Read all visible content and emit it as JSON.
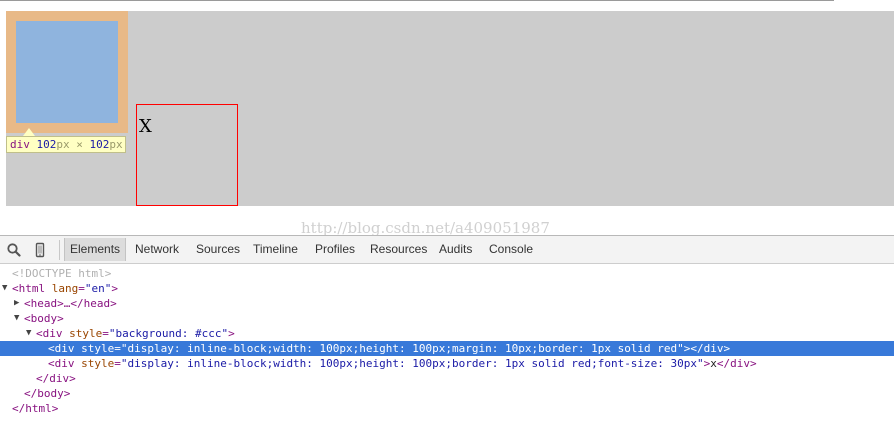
{
  "highlight_tooltip": {
    "tag": "div",
    "width": "102",
    "height": "102",
    "unit": "px",
    "times": "×"
  },
  "page_box_text": "X",
  "watermark": "http://blog.csdn.net/a409051987",
  "devtools": {
    "tabs": [
      {
        "label": "Elements",
        "active": true
      },
      {
        "label": "Network"
      },
      {
        "label": "Sources"
      },
      {
        "label": "Timeline"
      },
      {
        "label": "Profiles"
      },
      {
        "label": "Resources"
      },
      {
        "label": "Audits"
      },
      {
        "label": "Console"
      }
    ],
    "icons": [
      "search-icon",
      "device-mode-icon"
    ],
    "colors": {
      "selection": "#3879d9",
      "tag": "#881280",
      "attr": "#994500",
      "value": "#1a1aa6",
      "highlight_margin": "#e8b987",
      "highlight_content": "#8fb4de"
    },
    "dom": {
      "doctype": "<!DOCTYPE html>",
      "html_open_tag": "<html",
      "html_lang_attr": "lang",
      "html_lang_val": "\"en\"",
      "html_open_close": ">",
      "head_collapsed": "<head>…</head>",
      "body_open": "<body>",
      "div_open_tag": "<div",
      "style_attr": "style",
      "eq": "=",
      "outer_div_style": "\"background: #ccc\"",
      "tag_close": ">",
      "selected_div_style": "\"display: inline-block;width: 100px;height: 100px;margin: 10px;border: 1px solid red\"",
      "empty_div_end": "></div>",
      "second_div_style": "\"display: inline-block;width: 100px;height: 100px;border: 1px solid red;font-size: 30px\"",
      "second_div_text": "x",
      "div_close": "</div>",
      "body_close": "</body>",
      "html_close": "</html>"
    }
  }
}
